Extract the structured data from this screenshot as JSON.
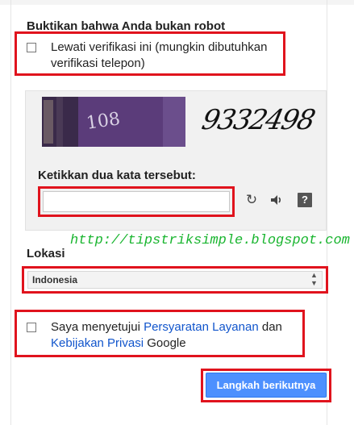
{
  "robot": {
    "title": "Buktikan bahwa Anda bukan robot",
    "skip_checked": false,
    "skip_label": "Lewati verifikasi ini (mungkin dibutuhkan verifikasi telepon)"
  },
  "captcha": {
    "image_text_1": "108",
    "image_text_2": "9332498",
    "input_label": "Ketikkan dua kata tersebut:",
    "input_value": "",
    "refresh_glyph": "↻",
    "audio_glyph": "🔊",
    "help_glyph": "?"
  },
  "watermark": "http://tipstriksimple.blogspot.com",
  "location": {
    "label": "Lokasi",
    "selected": "Indonesia",
    "arrows": "▲▼"
  },
  "terms": {
    "checked": false,
    "prefix": "Saya menyetujui ",
    "terms_link": "Persyaratan Layanan",
    "middle": " dan ",
    "privacy_link": "Kebijakan Privasi",
    "suffix": " Google"
  },
  "next_button": "Langkah berikutnya",
  "colors": {
    "highlight_border": "#e0131d",
    "primary_button": "#4d90fe",
    "link": "#1155cc",
    "watermark": "#19b52f"
  }
}
